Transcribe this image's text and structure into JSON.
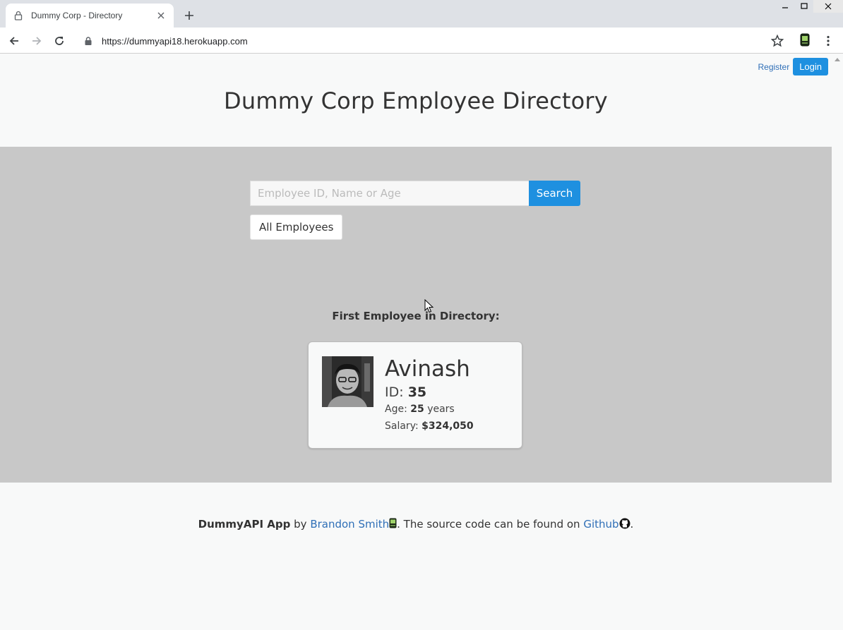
{
  "browser": {
    "tab_title": "Dummy Corp - Directory",
    "url": "https://dummyapi18.herokuapp.com",
    "icons": [
      "lock-icon",
      "back-icon",
      "forward-icon",
      "reload-icon",
      "star-icon",
      "extension-icon",
      "menu-icon",
      "close-icon",
      "new-tab-icon"
    ]
  },
  "header": {
    "register_label": "Register",
    "login_label": "Login"
  },
  "page_title": "Dummy Corp Employee Directory",
  "search": {
    "placeholder": "Employee ID, Name or Age",
    "value": "",
    "button_label": "Search",
    "all_employees_label": "All Employees"
  },
  "first_employee": {
    "section_label": "First Employee in Directory:",
    "name": "Avinash",
    "id_label": "ID:",
    "id": "35",
    "age_label": "Age:",
    "age": "25",
    "age_unit": "years",
    "salary_label": "Salary:",
    "salary": "$324,050"
  },
  "footer": {
    "app_name": "DummyAPI App",
    "by_text": "by",
    "author": "Brandon Smith",
    "source_text": ". The source code can be found on",
    "github_label": "Github",
    "end_text": "."
  },
  "colors": {
    "accent": "#1e90e0",
    "band": "#c8c8c8",
    "link": "#2f6fb7",
    "page_bg": "#f8f9f9"
  }
}
